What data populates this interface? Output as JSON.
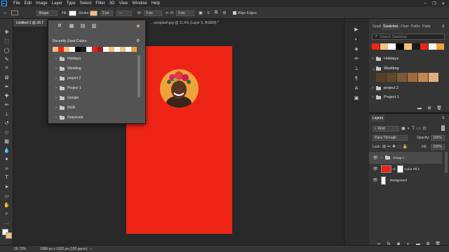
{
  "app": {
    "logo": "Ps",
    "menus": [
      "File",
      "Edit",
      "Image",
      "Layer",
      "Type",
      "Select",
      "Filter",
      "3D",
      "View",
      "Window",
      "Help"
    ],
    "window_controls": [
      "–",
      "❐",
      "✕"
    ]
  },
  "options_bar": {
    "mode_value": "Shape",
    "fill_label": "Fill:",
    "stroke_label": "Stroke:",
    "stroke_width": "2 px",
    "w_label": "W:",
    "w_value": "0 px",
    "h_label": "H:",
    "h_value": "0 px",
    "align_edges_label": "Align Edges",
    "fill_color": "#f6c07a",
    "stroke_color": "#ffffff"
  },
  "tabs": {
    "active": "Untitled-1 @ 29.7",
    "second": "…-unsplash.jpg @ 11.4% (Layer 0, RGB/8) *"
  },
  "swatch_popup": {
    "header": "Recently Used Colors",
    "recent_colors": [
      "#f6c07a",
      "#ee2416",
      "#f6c07a",
      "#ffffff",
      "#000000",
      "#1a1a1a",
      "#ffffff",
      "#e41f1f",
      "#9a1a1a",
      "#ffffff",
      "#f6c07a",
      "#ffffff",
      "#f6c07a",
      "#ffffff",
      "#f2a03a"
    ],
    "groups": [
      "Holidays",
      "Wedding",
      "project 2",
      "Project 1",
      "Google",
      "RGB",
      "Grayscale"
    ],
    "icons": [
      "fill-color-icon",
      "gradient-icon",
      "pattern-icon",
      "no-color-icon",
      "color-picker-icon"
    ]
  },
  "dock_icons": [
    "play-icon",
    "adjust-icon",
    "color-picker-icon",
    "brush-settings-icon",
    "clone-icon",
    "paragraph-icon",
    "character-icon",
    "layer-comps-icon"
  ],
  "swatches_panel": {
    "tabs": [
      "Gradi",
      "Swatches",
      "Chan",
      "Paths",
      "Patte"
    ],
    "active_tab": "Swatches",
    "search_placeholder": "Search Swatches",
    "recent": [
      "#ee2416",
      "#f6c07a",
      "#ffffff",
      "#000000",
      "#f6c07a",
      "#1a1a1a",
      "#ee2416",
      "#ffffff",
      "#f2a03a"
    ],
    "groups": [
      {
        "name": "Holidays",
        "expanded": false
      },
      {
        "name": "Wedding",
        "expanded": true,
        "colors": [
          "#5a3f2a",
          "#5e4a30",
          "#7d5a3a",
          "#a06a3c",
          "#c38750",
          "#e0b17a"
        ]
      },
      {
        "name": "project 2",
        "expanded": false
      },
      {
        "name": "Project 1",
        "expanded": false
      }
    ]
  },
  "layers_panel": {
    "tab": "Layers",
    "kind_label": "Kind",
    "blend_mode": "Pass Through",
    "opacity_label": "Opacity:",
    "opacity_value": "100%",
    "lock_label": "Lock:",
    "fill_label": "Fill:",
    "fill_value": "100%",
    "layers": [
      {
        "name": "Group 1",
        "type": "group",
        "selected": true
      },
      {
        "name": "Color Fill 1",
        "type": "fill",
        "selected": false
      },
      {
        "name": "Background",
        "type": "background",
        "selected": false
      }
    ],
    "fill_layer_color": "#ee2416"
  },
  "status": {
    "zoom": "29.73%",
    "info": "1080 px x 1920 px (150 ppcm)"
  },
  "canvas": {
    "artboard_color": "#ee2416",
    "circle_color": "#f0a33c"
  }
}
